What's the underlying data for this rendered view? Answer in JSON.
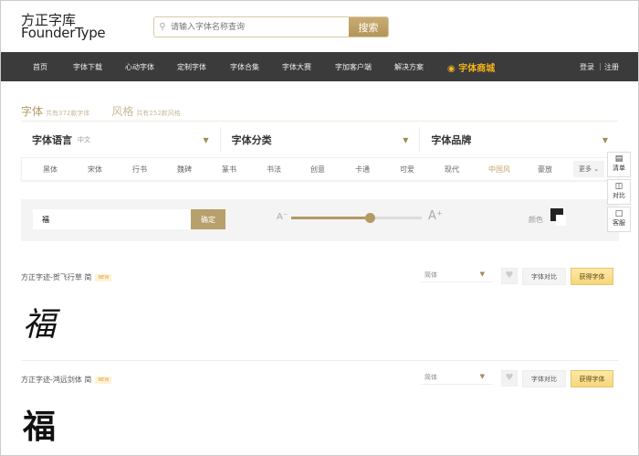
{
  "logo": {
    "cn": "方正字库",
    "en": "FounderType"
  },
  "search": {
    "placeholder": "请输入字体名称查询",
    "button": "搜索"
  },
  "nav": {
    "items": [
      "首页",
      "字体下载",
      "心动字体",
      "定制字体",
      "字体合集",
      "字体大赛",
      "字加客户端",
      "解决方案"
    ],
    "shop": "字体商城",
    "login": "登录",
    "register": "注册",
    "sep": "|"
  },
  "tabs": [
    {
      "label": "字体",
      "sub": "共有372款字体"
    },
    {
      "label": "风格",
      "sub": "共有252款风格"
    }
  ],
  "filters": [
    {
      "label": "字体语言",
      "value": "中文"
    },
    {
      "label": "字体分类",
      "value": ""
    },
    {
      "label": "字体品牌",
      "value": ""
    }
  ],
  "categories": [
    "黑体",
    "宋体",
    "行书",
    "魏碑",
    "篆书",
    "书法",
    "创意",
    "卡通",
    "可爱",
    "现代",
    "中国风",
    "豪放"
  ],
  "active_category": "中国风",
  "more": "更多",
  "preview": {
    "text": "福",
    "confirm": "确定",
    "size_percent": 60,
    "color_label": "颜色",
    "color": "#222222",
    "a_minus": "A⁻",
    "a_plus": "A⁺"
  },
  "side": [
    {
      "icon": "list-icon",
      "label": "清单"
    },
    {
      "icon": "compare-icon",
      "label": "对比"
    },
    {
      "icon": "chat-icon",
      "label": "客服"
    }
  ],
  "fonts": [
    {
      "name": "方正字迹-贺飞行草 简",
      "badge": "NEW",
      "variant": "简体",
      "compare": "字体对比",
      "get": "获得字体",
      "sample": "福"
    },
    {
      "name": "方正字迹-鸿远剑体 简",
      "badge": "NEW",
      "variant": "简体",
      "compare": "字体对比",
      "get": "获得字体",
      "sample": "福"
    }
  ],
  "colors": {
    "accent": "#b39a63",
    "nav": "#3b3b3b",
    "shop": "#f2b31c"
  }
}
